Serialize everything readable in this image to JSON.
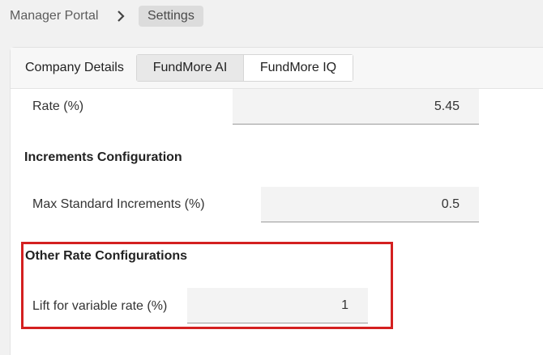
{
  "breadcrumb": {
    "root": "Manager Portal",
    "current": "Settings"
  },
  "tabs": {
    "company_details": "Company Details",
    "fundmore_ai": "FundMore AI",
    "fundmore_iq": "FundMore IQ",
    "active": "FundMore AI"
  },
  "fields": {
    "rate": {
      "label": "Rate (%)",
      "value": "5.45"
    },
    "increments_heading": "Increments Configuration",
    "max_standard_increments": {
      "label": "Max Standard Increments (%)",
      "value": "0.5"
    },
    "other_rate_heading": "Other Rate Configurations",
    "lift_variable_rate": {
      "label": "Lift for variable rate (%)",
      "value": "1"
    }
  },
  "colors": {
    "highlight": "#d42020",
    "active_tab_bg": "#e8e8e8"
  }
}
